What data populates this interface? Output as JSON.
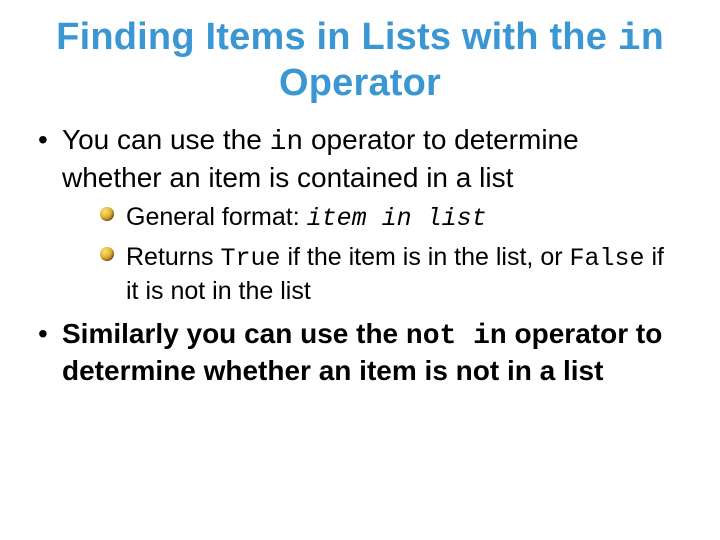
{
  "title": {
    "line_pre": "Finding Items in Lists with the ",
    "code": "in",
    "line_post": " Operator"
  },
  "bullets": {
    "b1": {
      "t1": "You can use the ",
      "code": "in",
      "t2": " operator to determine whether an item is contained in a list"
    },
    "b2": {
      "sub1": {
        "t1": "General format: ",
        "code": "item in list"
      },
      "sub2": {
        "t1": "Returns ",
        "code1": "True",
        "t2": " if the item is in the list, or ",
        "code2": "False",
        "t3": " if it is not in the list"
      }
    },
    "b3": {
      "t1": "Similarly you can use the ",
      "code": "not in",
      "t2": " operator to determine whether an item is not in a list"
    }
  }
}
